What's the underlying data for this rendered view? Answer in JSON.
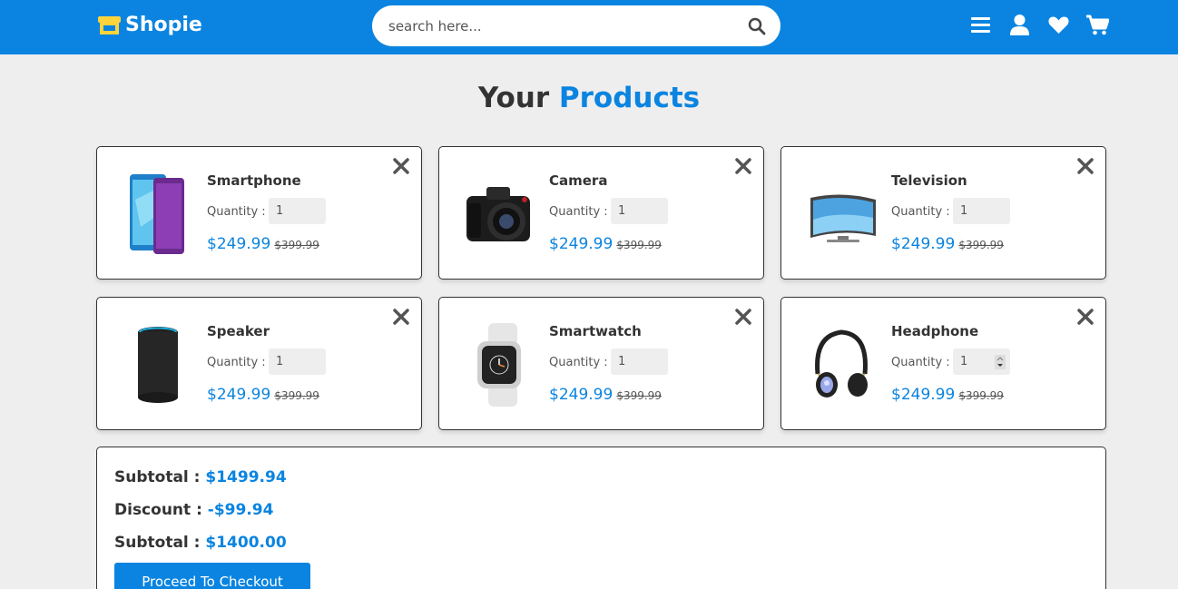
{
  "header": {
    "brand": "Shopie",
    "search_placeholder": "search here...",
    "icons": [
      "menu-icon",
      "user-icon",
      "heart-icon",
      "cart-icon"
    ]
  },
  "colors": {
    "accent": "#0a84e0",
    "background": "#eeeeee",
    "text": "#333333"
  },
  "section": {
    "title_prefix": "Your",
    "title_accent": "Products"
  },
  "products": [
    {
      "name": "Smartphone",
      "qty_label": "Quantity :",
      "qty": "1",
      "price": "$249.99",
      "old_price": "$399.99",
      "image": "smartphone-image"
    },
    {
      "name": "Camera",
      "qty_label": "Quantity :",
      "qty": "1",
      "price": "$249.99",
      "old_price": "$399.99",
      "image": "camera-image"
    },
    {
      "name": "Television",
      "qty_label": "Quantity :",
      "qty": "1",
      "price": "$249.99",
      "old_price": "$399.99",
      "image": "television-image"
    },
    {
      "name": "Speaker",
      "qty_label": "Quantity :",
      "qty": "1",
      "price": "$249.99",
      "old_price": "$399.99",
      "image": "speaker-image"
    },
    {
      "name": "Smartwatch",
      "qty_label": "Quantity :",
      "qty": "1",
      "price": "$249.99",
      "old_price": "$399.99",
      "image": "smartwatch-image"
    },
    {
      "name": "Headphone",
      "qty_label": "Quantity :",
      "qty": "1",
      "price": "$249.99",
      "old_price": "$399.99",
      "image": "headphone-image"
    }
  ],
  "summary": {
    "subtotal_label": "Subtotal :",
    "subtotal_value": "$1499.94",
    "discount_label": "Discount :",
    "discount_value": "-$99.94",
    "total_label": "Subtotal :",
    "total_value": "$1400.00",
    "checkout_label": "Proceed To Checkout"
  }
}
